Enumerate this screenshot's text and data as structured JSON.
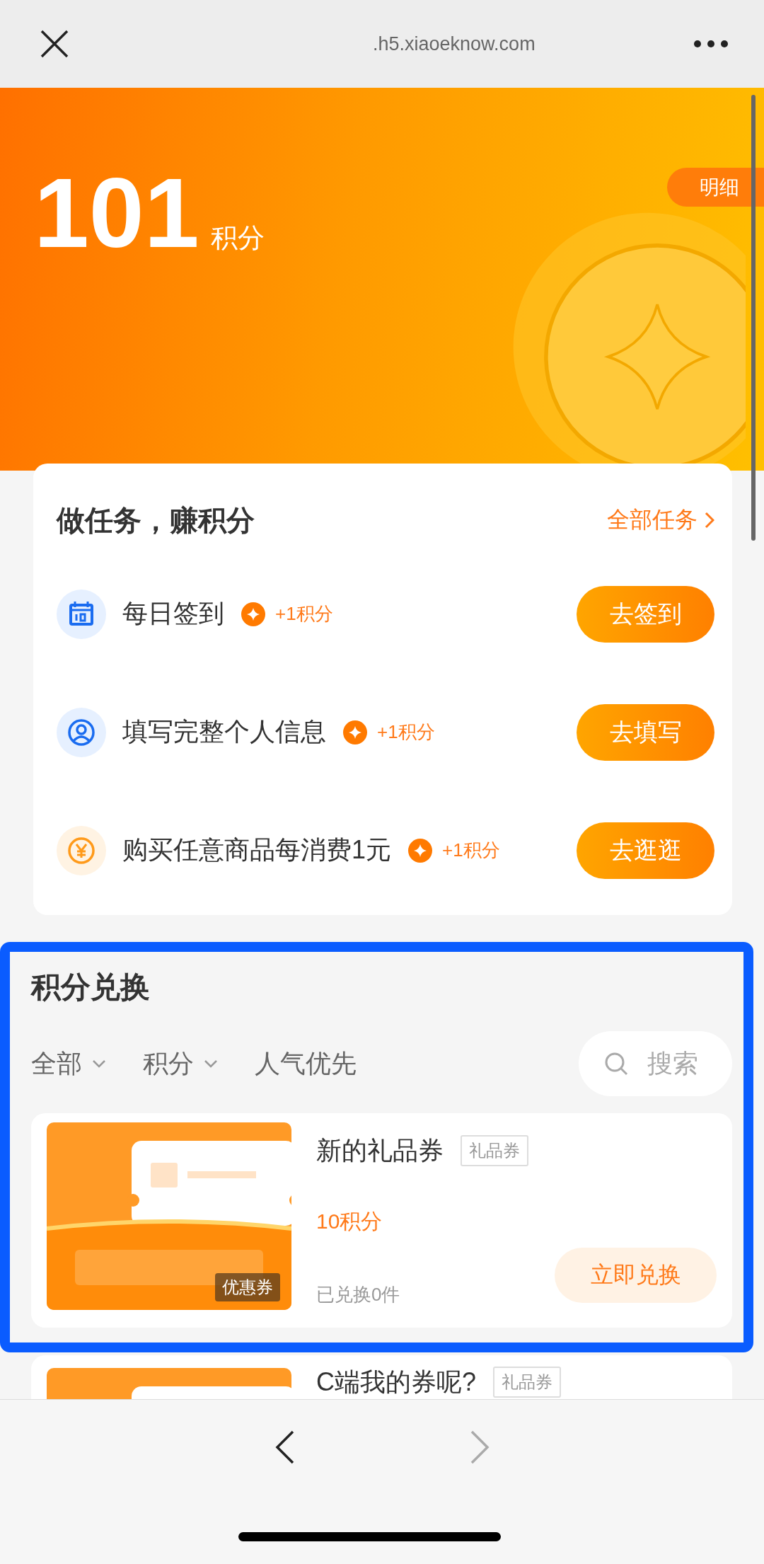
{
  "browser_bar": {
    "url": ".h5.xiaoeknow.com"
  },
  "points": {
    "value": "101",
    "unit": "积分",
    "detail_button": "明细"
  },
  "tasks": {
    "title": "做任务，赚积分",
    "all_link": "全部任务",
    "items": [
      {
        "kind": "calendar",
        "name": "每日签到",
        "reward": "+1积分",
        "button": "去签到"
      },
      {
        "kind": "profile",
        "name": "填写完整个人信息",
        "reward": "+1积分",
        "button": "去填写"
      },
      {
        "kind": "purchase",
        "name": "购买任意商品每消费1元",
        "reward": "+1积分",
        "button": "去逛逛"
      }
    ]
  },
  "exchange": {
    "title": "积分兑换",
    "filters": [
      {
        "label": "全部",
        "kind": "dropdown"
      },
      {
        "label": "积分",
        "kind": "dropdown"
      },
      {
        "label": "人气优先",
        "kind": "plain"
      }
    ],
    "search": {
      "placeholder": "搜索"
    },
    "products": [
      {
        "title": "新的礼品券",
        "tag": "礼品券",
        "image_label": "优惠券",
        "price": "10积分",
        "sold": "已兑换0件",
        "button": "立即兑换"
      }
    ]
  },
  "next_products": [
    {
      "title": "C端我的券呢?",
      "tag": "礼品券"
    }
  ]
}
